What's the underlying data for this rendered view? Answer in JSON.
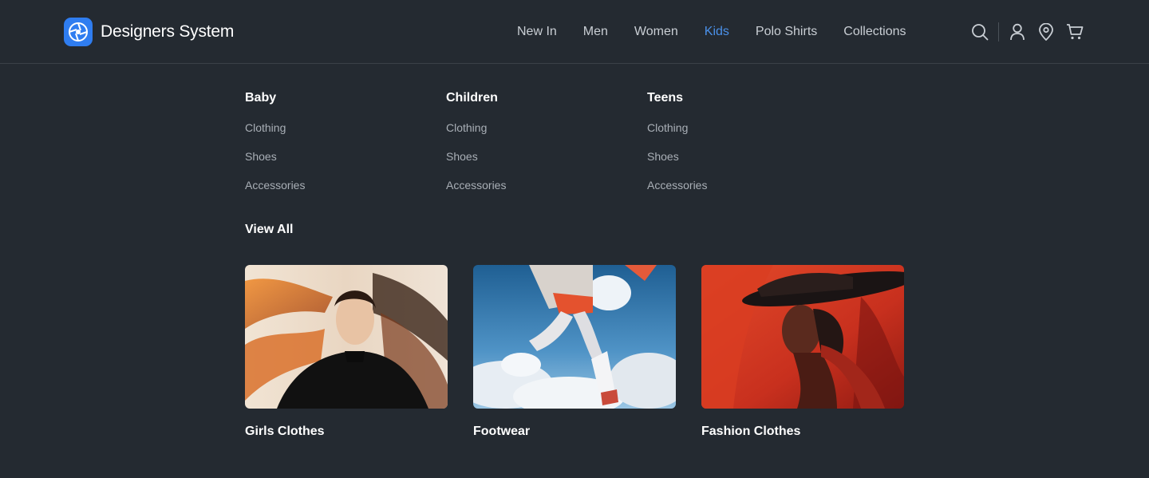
{
  "brand": {
    "name": "Designers System",
    "logo_icon": "aperture-icon",
    "accent": "#2f7df0"
  },
  "nav": {
    "items": [
      {
        "label": "New In",
        "active": false
      },
      {
        "label": "Men",
        "active": false
      },
      {
        "label": "Women",
        "active": false
      },
      {
        "label": "Kids",
        "active": true
      },
      {
        "label": "Polo Shirts",
        "active": false
      },
      {
        "label": "Collections",
        "active": false
      }
    ],
    "active_color": "#4a90e8"
  },
  "toolbar_icons": [
    "search-icon",
    "user-icon",
    "location-pin-icon",
    "cart-icon"
  ],
  "menu": {
    "columns": [
      {
        "title": "Baby",
        "links": [
          "Clothing",
          "Shoes",
          "Accessories"
        ]
      },
      {
        "title": "Children",
        "links": [
          "Clothing",
          "Shoes",
          "Accessories"
        ]
      },
      {
        "title": "Teens",
        "links": [
          "Clothing",
          "Shoes",
          "Accessories"
        ]
      }
    ],
    "view_all": "View All"
  },
  "cards": [
    {
      "caption": "Girls Clothes"
    },
    {
      "caption": "Footwear"
    },
    {
      "caption": "Fashion Clothes"
    }
  ]
}
